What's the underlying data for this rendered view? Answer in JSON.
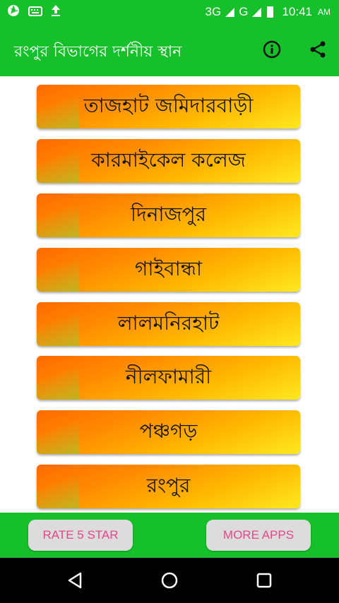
{
  "status_bar": {
    "network": "3G",
    "network2": "G",
    "time": "10:41",
    "ampm": "AM"
  },
  "toolbar": {
    "title": "রংপুর বিভাগের দর্শনীয় স্থান"
  },
  "places": [
    {
      "label": "তাজহাট জমিদারবাড়ী"
    },
    {
      "label": "কারমাইকেল কলেজ"
    },
    {
      "label": "দিনাজপুর"
    },
    {
      "label": "গাইবান্ধা"
    },
    {
      "label": "লালমনিরহাট"
    },
    {
      "label": "নীলফামারী"
    },
    {
      "label": "পঞ্চগড়"
    },
    {
      "label": "রংপুর"
    }
  ],
  "bottom_bar": {
    "rate_label": "RATE 5 STAR",
    "more_label": "MORE APPS"
  },
  "colors": {
    "primary_green": "#16c02a",
    "button_orange": "#ff6a00",
    "button_yellow": "#ffe820",
    "pill_text": "#e8458a"
  }
}
